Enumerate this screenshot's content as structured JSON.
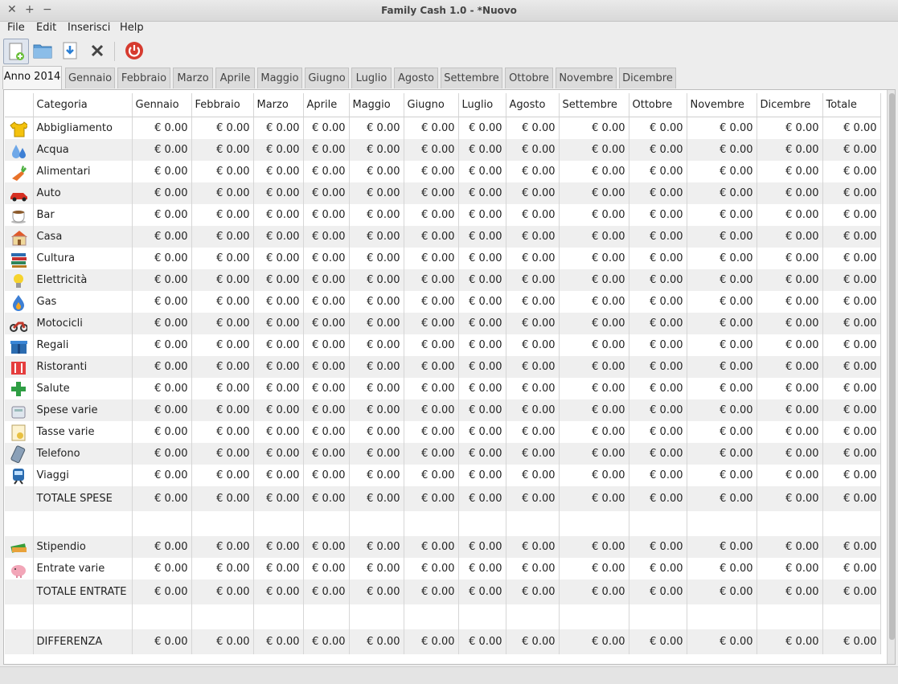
{
  "window": {
    "title": "Family Cash 1.0 - *Nuovo",
    "close": "✕",
    "maximize": "+",
    "minimize": "−"
  },
  "menu": [
    "File",
    "Edit",
    "Inserisci",
    "Help"
  ],
  "toolbar": {
    "icons": [
      "new-document-icon",
      "open-folder-icon",
      "save-icon",
      "close-icon",
      "power-icon"
    ]
  },
  "tabs": [
    "Anno 2014",
    "Gennaio",
    "Febbraio",
    "Marzo",
    "Aprile",
    "Maggio",
    "Giugno",
    "Luglio",
    "Agosto",
    "Settembre",
    "Ottobre",
    "Novembre",
    "Dicembre"
  ],
  "table": {
    "headers": [
      "Categoria",
      "Gennaio",
      "Febbraio",
      "Marzo",
      "Aprile",
      "Maggio",
      "Giugno",
      "Luglio",
      "Agosto",
      "Settembre",
      "Ottobre",
      "Novembre",
      "Dicembre",
      "Totale"
    ],
    "rows": [
      {
        "icon": "tshirt-icon",
        "label": "Abbigliamento",
        "values": [
          "€ 0.00",
          "€ 0.00",
          "€ 0.00",
          "€ 0.00",
          "€ 0.00",
          "€ 0.00",
          "€ 0.00",
          "€ 0.00",
          "€ 0.00",
          "€ 0.00",
          "€ 0.00",
          "€ 0.00",
          "€ 0.00"
        ]
      },
      {
        "icon": "water-drops-icon",
        "label": "Acqua",
        "values": [
          "€ 0.00",
          "€ 0.00",
          "€ 0.00",
          "€ 0.00",
          "€ 0.00",
          "€ 0.00",
          "€ 0.00",
          "€ 0.00",
          "€ 0.00",
          "€ 0.00",
          "€ 0.00",
          "€ 0.00",
          "€ 0.00"
        ]
      },
      {
        "icon": "carrot-icon",
        "label": "Alimentari",
        "values": [
          "€ 0.00",
          "€ 0.00",
          "€ 0.00",
          "€ 0.00",
          "€ 0.00",
          "€ 0.00",
          "€ 0.00",
          "€ 0.00",
          "€ 0.00",
          "€ 0.00",
          "€ 0.00",
          "€ 0.00",
          "€ 0.00"
        ]
      },
      {
        "icon": "car-icon",
        "label": "Auto",
        "values": [
          "€ 0.00",
          "€ 0.00",
          "€ 0.00",
          "€ 0.00",
          "€ 0.00",
          "€ 0.00",
          "€ 0.00",
          "€ 0.00",
          "€ 0.00",
          "€ 0.00",
          "€ 0.00",
          "€ 0.00",
          "€ 0.00"
        ]
      },
      {
        "icon": "coffee-cup-icon",
        "label": "Bar",
        "values": [
          "€ 0.00",
          "€ 0.00",
          "€ 0.00",
          "€ 0.00",
          "€ 0.00",
          "€ 0.00",
          "€ 0.00",
          "€ 0.00",
          "€ 0.00",
          "€ 0.00",
          "€ 0.00",
          "€ 0.00",
          "€ 0.00"
        ]
      },
      {
        "icon": "house-icon",
        "label": "Casa",
        "values": [
          "€ 0.00",
          "€ 0.00",
          "€ 0.00",
          "€ 0.00",
          "€ 0.00",
          "€ 0.00",
          "€ 0.00",
          "€ 0.00",
          "€ 0.00",
          "€ 0.00",
          "€ 0.00",
          "€ 0.00",
          "€ 0.00"
        ]
      },
      {
        "icon": "books-icon",
        "label": "Cultura",
        "values": [
          "€ 0.00",
          "€ 0.00",
          "€ 0.00",
          "€ 0.00",
          "€ 0.00",
          "€ 0.00",
          "€ 0.00",
          "€ 0.00",
          "€ 0.00",
          "€ 0.00",
          "€ 0.00",
          "€ 0.00",
          "€ 0.00"
        ]
      },
      {
        "icon": "lightbulb-icon",
        "label": "Elettricità",
        "values": [
          "€ 0.00",
          "€ 0.00",
          "€ 0.00",
          "€ 0.00",
          "€ 0.00",
          "€ 0.00",
          "€ 0.00",
          "€ 0.00",
          "€ 0.00",
          "€ 0.00",
          "€ 0.00",
          "€ 0.00",
          "€ 0.00"
        ]
      },
      {
        "icon": "gas-flame-icon",
        "label": "Gas",
        "values": [
          "€ 0.00",
          "€ 0.00",
          "€ 0.00",
          "€ 0.00",
          "€ 0.00",
          "€ 0.00",
          "€ 0.00",
          "€ 0.00",
          "€ 0.00",
          "€ 0.00",
          "€ 0.00",
          "€ 0.00",
          "€ 0.00"
        ]
      },
      {
        "icon": "motorcycle-icon",
        "label": "Motocicli",
        "values": [
          "€ 0.00",
          "€ 0.00",
          "€ 0.00",
          "€ 0.00",
          "€ 0.00",
          "€ 0.00",
          "€ 0.00",
          "€ 0.00",
          "€ 0.00",
          "€ 0.00",
          "€ 0.00",
          "€ 0.00",
          "€ 0.00"
        ]
      },
      {
        "icon": "gift-icon",
        "label": "Regali",
        "values": [
          "€ 0.00",
          "€ 0.00",
          "€ 0.00",
          "€ 0.00",
          "€ 0.00",
          "€ 0.00",
          "€ 0.00",
          "€ 0.00",
          "€ 0.00",
          "€ 0.00",
          "€ 0.00",
          "€ 0.00",
          "€ 0.00"
        ]
      },
      {
        "icon": "restaurant-icon",
        "label": "Ristoranti",
        "values": [
          "€ 0.00",
          "€ 0.00",
          "€ 0.00",
          "€ 0.00",
          "€ 0.00",
          "€ 0.00",
          "€ 0.00",
          "€ 0.00",
          "€ 0.00",
          "€ 0.00",
          "€ 0.00",
          "€ 0.00",
          "€ 0.00"
        ]
      },
      {
        "icon": "pharmacy-cross-icon",
        "label": "Salute",
        "values": [
          "€ 0.00",
          "€ 0.00",
          "€ 0.00",
          "€ 0.00",
          "€ 0.00",
          "€ 0.00",
          "€ 0.00",
          "€ 0.00",
          "€ 0.00",
          "€ 0.00",
          "€ 0.00",
          "€ 0.00",
          "€ 0.00"
        ]
      },
      {
        "icon": "calculator-icon",
        "label": "Spese varie",
        "values": [
          "€ 0.00",
          "€ 0.00",
          "€ 0.00",
          "€ 0.00",
          "€ 0.00",
          "€ 0.00",
          "€ 0.00",
          "€ 0.00",
          "€ 0.00",
          "€ 0.00",
          "€ 0.00",
          "€ 0.00",
          "€ 0.00"
        ]
      },
      {
        "icon": "tax-document-icon",
        "label": "Tasse varie",
        "values": [
          "€ 0.00",
          "€ 0.00",
          "€ 0.00",
          "€ 0.00",
          "€ 0.00",
          "€ 0.00",
          "€ 0.00",
          "€ 0.00",
          "€ 0.00",
          "€ 0.00",
          "€ 0.00",
          "€ 0.00",
          "€ 0.00"
        ]
      },
      {
        "icon": "phone-icon",
        "label": "Telefono",
        "values": [
          "€ 0.00",
          "€ 0.00",
          "€ 0.00",
          "€ 0.00",
          "€ 0.00",
          "€ 0.00",
          "€ 0.00",
          "€ 0.00",
          "€ 0.00",
          "€ 0.00",
          "€ 0.00",
          "€ 0.00",
          "€ 0.00"
        ]
      },
      {
        "icon": "train-icon",
        "label": "Viaggi",
        "values": [
          "€ 0.00",
          "€ 0.00",
          "€ 0.00",
          "€ 0.00",
          "€ 0.00",
          "€ 0.00",
          "€ 0.00",
          "€ 0.00",
          "€ 0.00",
          "€ 0.00",
          "€ 0.00",
          "€ 0.00",
          "€ 0.00"
        ]
      }
    ],
    "total_spese": {
      "label": "TOTALE SPESE",
      "values": [
        "€ 0.00",
        "€ 0.00",
        "€ 0.00",
        "€ 0.00",
        "€ 0.00",
        "€ 0.00",
        "€ 0.00",
        "€ 0.00",
        "€ 0.00",
        "€ 0.00",
        "€ 0.00",
        "€ 0.00",
        "€ 0.00"
      ]
    },
    "income_rows": [
      {
        "icon": "money-icon",
        "label": "Stipendio",
        "values": [
          "€ 0.00",
          "€ 0.00",
          "€ 0.00",
          "€ 0.00",
          "€ 0.00",
          "€ 0.00",
          "€ 0.00",
          "€ 0.00",
          "€ 0.00",
          "€ 0.00",
          "€ 0.00",
          "€ 0.00",
          "€ 0.00"
        ]
      },
      {
        "icon": "piggy-bank-icon",
        "label": "Entrate varie",
        "values": [
          "€ 0.00",
          "€ 0.00",
          "€ 0.00",
          "€ 0.00",
          "€ 0.00",
          "€ 0.00",
          "€ 0.00",
          "€ 0.00",
          "€ 0.00",
          "€ 0.00",
          "€ 0.00",
          "€ 0.00",
          "€ 0.00"
        ]
      }
    ],
    "total_entrate": {
      "label": "TOTALE ENTRATE",
      "values": [
        "€ 0.00",
        "€ 0.00",
        "€ 0.00",
        "€ 0.00",
        "€ 0.00",
        "€ 0.00",
        "€ 0.00",
        "€ 0.00",
        "€ 0.00",
        "€ 0.00",
        "€ 0.00",
        "€ 0.00",
        "€ 0.00"
      ]
    },
    "differenza": {
      "label": "DIFFERENZA",
      "values": [
        "€ 0.00",
        "€ 0.00",
        "€ 0.00",
        "€ 0.00",
        "€ 0.00",
        "€ 0.00",
        "€ 0.00",
        "€ 0.00",
        "€ 0.00",
        "€ 0.00",
        "€ 0.00",
        "€ 0.00",
        "€ 0.00"
      ]
    }
  }
}
